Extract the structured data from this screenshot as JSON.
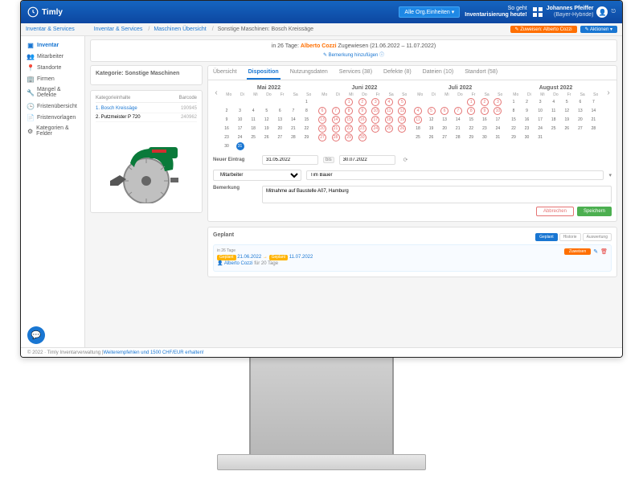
{
  "brand": "Timly",
  "header": {
    "all_units": "Alle Org.Einheiten ▾",
    "tagline1": "So geht",
    "tagline2": "Inventarisierung heute!",
    "user_name": "Johannes Pfeiffer",
    "user_org": "(Bayer-Hybride)"
  },
  "subbar": {
    "link1": "Inventar & Services",
    "crumb1": "Inventar & Services",
    "crumb2": "Maschinen Übersicht",
    "crumb3": "Sonstige Maschinen: Bosch Kreissäge",
    "btn_orange": "✎ Zuweisen: Alberto Cozzi",
    "btn_blue": "✎ Aktionen ▾"
  },
  "sidebar": [
    {
      "icon": "▣",
      "label": "Inventar",
      "active": true
    },
    {
      "icon": "👥",
      "label": "Mitarbeiter"
    },
    {
      "icon": "📍",
      "label": "Standorte"
    },
    {
      "icon": "🏢",
      "label": "Firmen"
    },
    {
      "icon": "🔧",
      "label": "Mängel & Defekte"
    },
    {
      "icon": "🕒",
      "label": "Fristenübersicht"
    },
    {
      "icon": "📄",
      "label": "Fristenvorlagen"
    },
    {
      "icon": "⚙",
      "label": "Kategorien & Felder"
    }
  ],
  "alert": {
    "prefix": "in 26 Tage: ",
    "name": "Alberto Cozzi",
    "suffix": " Zugewiesen (21.06.2022 – 11.07.2022)",
    "sub": "✎ Bemerkung hinzufügen ⓘ"
  },
  "left": {
    "title": "Kategorie: Sonstige Maschinen",
    "subtitle": "Kategorieinhalte",
    "barcode_h": "Barcode",
    "items": [
      {
        "n": "1.",
        "name": "Bosch Kreissäge",
        "code": "190945",
        "active": true
      },
      {
        "n": "2.",
        "name": "Putzmeister P 720",
        "code": "240962"
      }
    ]
  },
  "tabs": [
    "Übersicht",
    "Disposition",
    "Nutzungsdaten",
    "Services (38)",
    "Defekte (8)",
    "Dateien (10)",
    "Standort (58)"
  ],
  "calendar": {
    "months": [
      "Mai 2022",
      "Juni 2022",
      "Juli 2022",
      "August 2022"
    ],
    "dow": [
      "Mo",
      "Di",
      "Mi",
      "Do",
      "Fr",
      "Sa",
      "So"
    ]
  },
  "form": {
    "new_label": "Neuer Eintrag",
    "from": "31.05.2022",
    "bis": "bis",
    "to": "30.07.2022",
    "type_label": "Mitarbeiter",
    "type_value": "Tim Bauer",
    "remark_label": "Bemerkung",
    "remark_value": "Mitnahme auf Baustelle A07, Hamburg",
    "cancel": "Abbrechen",
    "save": "Speichern"
  },
  "geplant": {
    "title": "Geplant",
    "tabs": [
      "Geplant",
      "Historie",
      "Auswertung"
    ],
    "entry_days": "in 26 Tage",
    "badge1": "Geplant",
    "date1": "21.06.2022",
    "badge2": "Geplant",
    "date2": "11.07.2022",
    "person": "Alberto Cozzi",
    "duration": "für 20 Tage",
    "action_btn": "Zuweisen"
  },
  "footer": {
    "copy": "© 2022 · Timly Inventarverwaltung | ",
    "link": "Weiterempfehlen und 1500 CHF/EUR erhalten!"
  }
}
